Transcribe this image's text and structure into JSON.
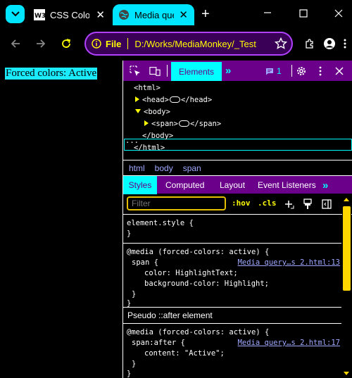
{
  "tabs": [
    {
      "title": "CSS Colors",
      "favicon": "w3schools-favicon"
    },
    {
      "title": "Media queries",
      "favicon": "globe-icon",
      "active": true
    }
  ],
  "address_bar": {
    "scheme_label": "File",
    "url": "D:/Works/MediaMonkey/_Test"
  },
  "page": {
    "forced_colors_text": "Forced colors: Active"
  },
  "devtools": {
    "active_tab": "Elements",
    "issues_count": "1",
    "dom": {
      "html_open": "<html>",
      "head_line": "</head>",
      "head_open": "<head>",
      "body_open": "<body>",
      "span_open": "<span>",
      "span_close": "</span>",
      "body_close": "</body>",
      "html_close": "</html>",
      "dots": "···"
    },
    "breadcrumbs": [
      "html",
      "body",
      "span"
    ],
    "panel_tabs": [
      "Styles",
      "Computed",
      "Layout",
      "Event Listeners"
    ],
    "filter_placeholder": "Filter",
    "hov_label": ":hov",
    "cls_label": ".cls",
    "rules": {
      "element_style": "element.style {",
      "close_brace": "}",
      "media1": "@media (forced-colors: active) {",
      "span_selector": "span {",
      "link1": "Media query…s 2.html:13",
      "decl_color": "color: HighlightText;",
      "decl_bg": "background-color: Highlight;",
      "pseudo_header": "Pseudo ::after element",
      "media2": "@media (forced-colors: active) {",
      "span_after_selector": "span:after {",
      "link2": "Media query…s 2.html:17",
      "decl_content": "content: \"Active\";"
    }
  },
  "colors": {
    "accent_cyan": "#00e5ff",
    "devtools_purple": "#6b008b",
    "highlight_yellow": "#ffff00",
    "link_blue": "#9ea8ff"
  }
}
